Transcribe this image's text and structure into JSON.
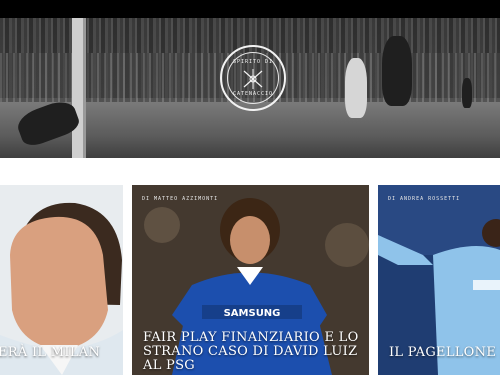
{
  "header": {
    "logo": {
      "text_top": "SPIRITO DI",
      "text_bottom": "CATENACCIO"
    }
  },
  "articles": [
    {
      "title": "ERÀ IL MILAN",
      "author": ""
    },
    {
      "title": "FAIR PLAY FINANZIARIO E LO STRANO CASO DI DAVID LUIZ AL PSG",
      "author": "DI MATTEO AZZIMONTI"
    },
    {
      "title": "IL PAGELLONE DELL'INVE",
      "author": "DI ANDREA ROSSETTI"
    }
  ],
  "colors": {
    "top_bar": "#000000",
    "chelsea_blue": "#1c4fae",
    "city_blue": "#8fc3ea"
  }
}
